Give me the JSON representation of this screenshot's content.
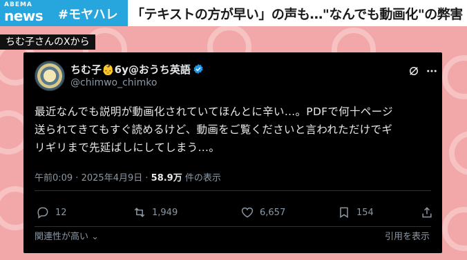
{
  "header": {
    "logo_top": "ABEMA",
    "logo_bottom": "news",
    "hashtag": "#モヤハレ",
    "headline": "「テキストの方が早い」の声も…\"なんでも動画化\"の弊害"
  },
  "source_label": "ちむ子さんのXから",
  "tweet": {
    "display_name": "ちむ子👶6y@おうち英語",
    "handle": "@chimwo_chimko",
    "text": "最近なんでも説明が動画化されていてほんとに辛い…。PDFで何十ページ\n送られてきてもすぐ読めるけど、動画をご覧くださいと言われただけでギ\nリギリまで先延ばしにしてしまう…。",
    "time": "午前0:09",
    "date": "2025年4月9日",
    "views": "58.9万",
    "views_label": "件の表示",
    "replies": "12",
    "reposts": "1,949",
    "likes": "6,657",
    "bookmarks": "154",
    "footer_left": "関連性が高い",
    "footer_right": "引用を表示"
  },
  "icons": {
    "verified": "verified-badge-icon",
    "grok": "grok-icon",
    "more": "more-icon",
    "reply": "reply-icon",
    "repost": "repost-icon",
    "like": "heart-icon",
    "bookmark": "bookmark-icon",
    "share": "share-icon"
  },
  "colors": {
    "accent": "#27a6de",
    "background": "#f2a8a8",
    "card": "#000000",
    "verified": "#1d9bf0",
    "muted": "#8b98a5"
  }
}
